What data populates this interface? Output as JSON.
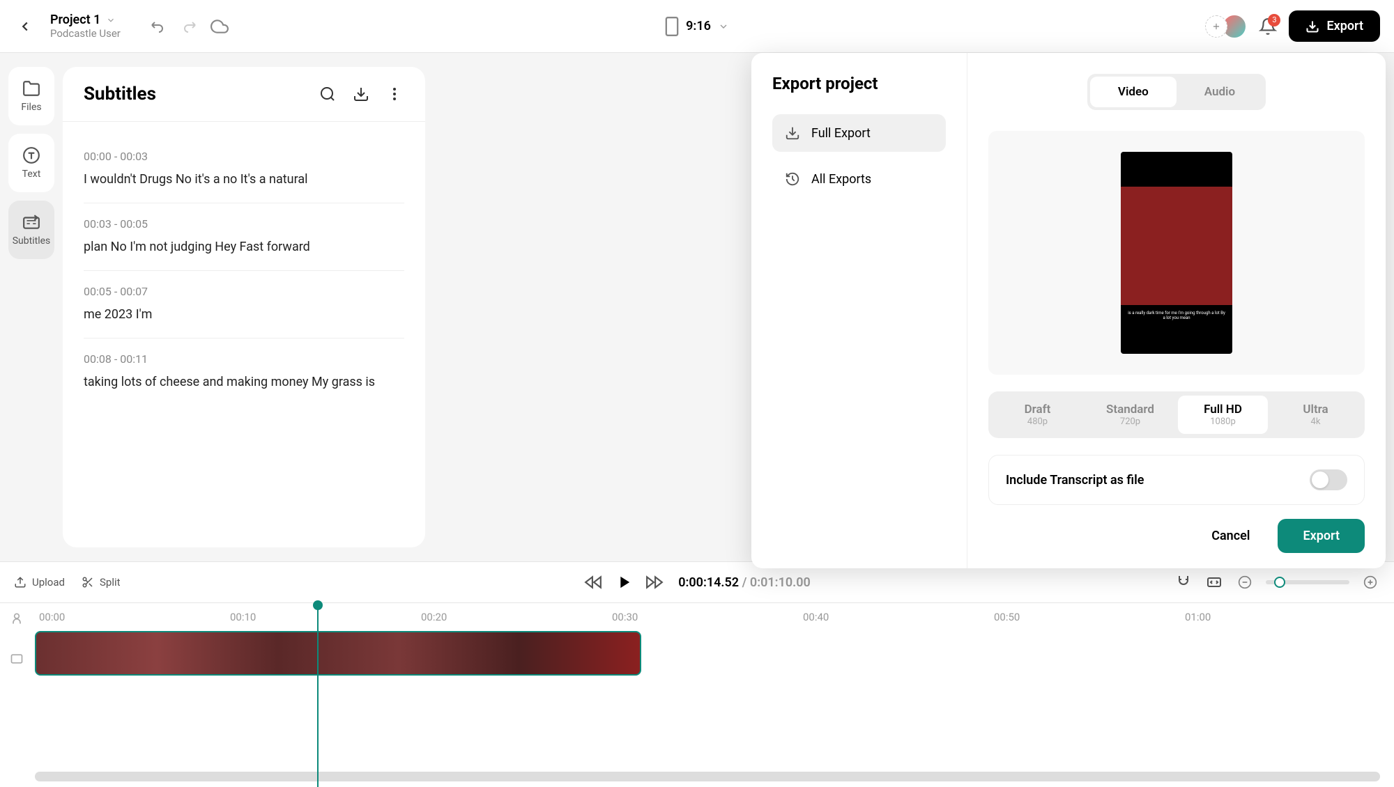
{
  "header": {
    "project_title": "Project 1",
    "project_user": "Podcastle User",
    "aspect": "9:16",
    "notification_count": "3",
    "export_label": "Export"
  },
  "rail": {
    "files": "Files",
    "text": "Text",
    "subtitles": "Subtitles"
  },
  "subtitles": {
    "title": "Subtitles",
    "items": [
      {
        "time": "00:00 - 00:03",
        "text": "I wouldn't Drugs No it's a no It's a natural"
      },
      {
        "time": "00:03 - 00:05",
        "text": "plan No I'm not judging Hey Fast forward"
      },
      {
        "time": "00:05 - 00:07",
        "text": "me 2023 I'm"
      },
      {
        "time": "00:08 - 00:11",
        "text": "taking lots of cheese and making money My grass is"
      }
    ]
  },
  "preview": {
    "caption": "is a really dark time for me I'm going through a lot By a lot you mean"
  },
  "export_modal": {
    "heading": "Export project",
    "full_export": "Full Export",
    "all_exports": "All Exports",
    "tab_video": "Video",
    "tab_audio": "Audio",
    "quality": [
      {
        "name": "Draft",
        "res": "480p"
      },
      {
        "name": "Standard",
        "res": "720p"
      },
      {
        "name": "Full HD",
        "res": "1080p"
      },
      {
        "name": "Ultra",
        "res": "4k"
      }
    ],
    "transcript_label": "Include Transcript as file",
    "cancel": "Cancel",
    "confirm": "Export"
  },
  "toolbar": {
    "upload": "Upload",
    "split": "Split",
    "time_current": "0:00:14.52",
    "time_total": "0:01:10.00"
  },
  "timeline": {
    "marks": [
      "00:00",
      "00:10",
      "00:20",
      "00:30",
      "00:40",
      "00:50",
      "01:00"
    ]
  }
}
